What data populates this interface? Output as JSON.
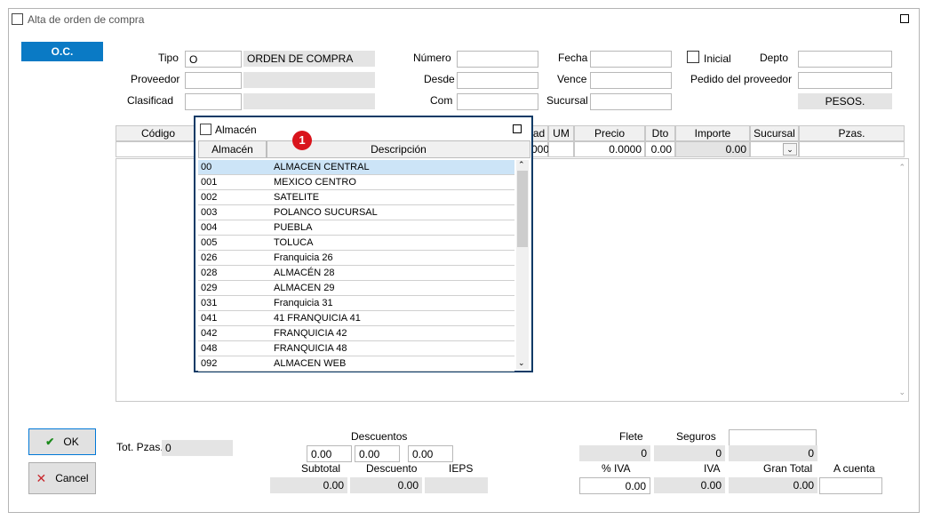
{
  "window": {
    "title": "Alta de orden de compra"
  },
  "tab": {
    "label": "O.C."
  },
  "header": {
    "tipo_label": "Tipo",
    "tipo_code": "O",
    "tipo_desc": "ORDEN DE COMPRA",
    "proveedor_label": "Proveedor",
    "clasificad_label": "Clasificad",
    "numero_label": "Número",
    "desde_label": "Desde",
    "com_label": "Com",
    "fecha_label": "Fecha",
    "vence_label": "Vence",
    "sucursal_label": "Sucursal",
    "inicial_label": "Inicial",
    "depto_label": "Depto",
    "pedido_label": "Pedido del proveedor",
    "currency": "PESOS."
  },
  "grid": {
    "columns": [
      "Código",
      "ad",
      "UM",
      "Precio",
      "Dto",
      "Importe",
      "Sucursal",
      "Pzas."
    ],
    "row": {
      "cantidad": "000",
      "precio": "0.0000",
      "dto": "0.00",
      "importe": "0.00"
    }
  },
  "popup": {
    "title": "Almacén",
    "columns": [
      "Almacén",
      "Descripción"
    ],
    "rows": [
      {
        "code": "00",
        "desc": "ALMACEN CENTRAL"
      },
      {
        "code": "001",
        "desc": "MEXICO CENTRO"
      },
      {
        "code": "002",
        "desc": "SATELITE"
      },
      {
        "code": "003",
        "desc": "POLANCO SUCURSAL"
      },
      {
        "code": "004",
        "desc": "PUEBLA"
      },
      {
        "code": "005",
        "desc": "TOLUCA"
      },
      {
        "code": "026",
        "desc": "Franquicia 26"
      },
      {
        "code": "028",
        "desc": "ALMACÉN 28"
      },
      {
        "code": "029",
        "desc": "ALMACEN 29"
      },
      {
        "code": "031",
        "desc": "Franquicia 31"
      },
      {
        "code": "041",
        "desc": "41 FRANQUICIA 41"
      },
      {
        "code": "042",
        "desc": "FRANQUICIA 42"
      },
      {
        "code": "048",
        "desc": "FRANQUICIA 48"
      },
      {
        "code": "092",
        "desc": "ALMACEN WEB"
      }
    ],
    "badge": "1"
  },
  "footer": {
    "ok_label": "OK",
    "cancel_label": "Cancel",
    "totpzas_label": "Tot. Pzas.",
    "totpzas_value": "0",
    "descuentos_label": "Descuentos",
    "desc1": "0.00",
    "desc2": "0.00",
    "desc3": "0.00",
    "subtotal_label": "Subtotal",
    "subtotal_value": "0.00",
    "descuento_label": "Descuento",
    "descuento_value": "0.00",
    "ieps_label": "IEPS",
    "flete_label": "Flete",
    "flete_value": "0",
    "seguros_label": "Seguros",
    "seguros_value": "0",
    "other_value": "0",
    "piva_label": "% IVA",
    "piva_value": "0.00",
    "iva_label": "IVA",
    "iva_value": "0.00",
    "grantotal_label": "Gran Total",
    "grantotal_value": "0.00",
    "acuenta_label": "A cuenta"
  },
  "colors": {
    "accent": "#0a7ac5",
    "popup_border": "#0b3a66",
    "selection": "#cce4f7",
    "badge": "#d9141c"
  }
}
